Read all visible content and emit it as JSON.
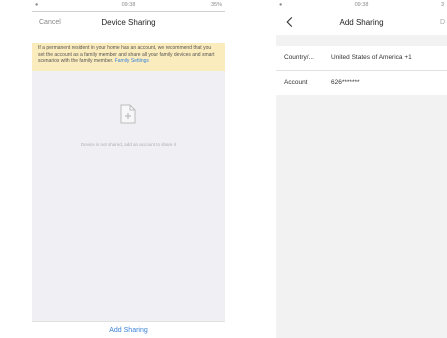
{
  "left_screen": {
    "status": {
      "carrier": "●",
      "time": "09:38",
      "battery": "35%"
    },
    "nav": {
      "cancel_label": "Cancel",
      "title": "Device Sharing"
    },
    "notice": {
      "text": "If a permanent resident in your home has an account, we recommend that you set the account as a family member and share all your family devices and smart scenarios with the family member.",
      "link": "Family Settings"
    },
    "empty_state": {
      "text": "Device is not shared, add an account to share it"
    },
    "bottom_button": "Add Sharing"
  },
  "right_screen": {
    "status": {
      "carrier": "●",
      "time": "09:38",
      "battery": "3"
    },
    "nav": {
      "title": "Add Sharing",
      "right_label": "D"
    },
    "form": {
      "rows": [
        {
          "label": "Country/...",
          "value": "United States of America +1"
        },
        {
          "label": "Account",
          "value": "626*******"
        }
      ]
    }
  },
  "colors": {
    "accent": "#3b84d8",
    "notice_bg": "#fbecbd",
    "page_bg": "#efeff4"
  }
}
